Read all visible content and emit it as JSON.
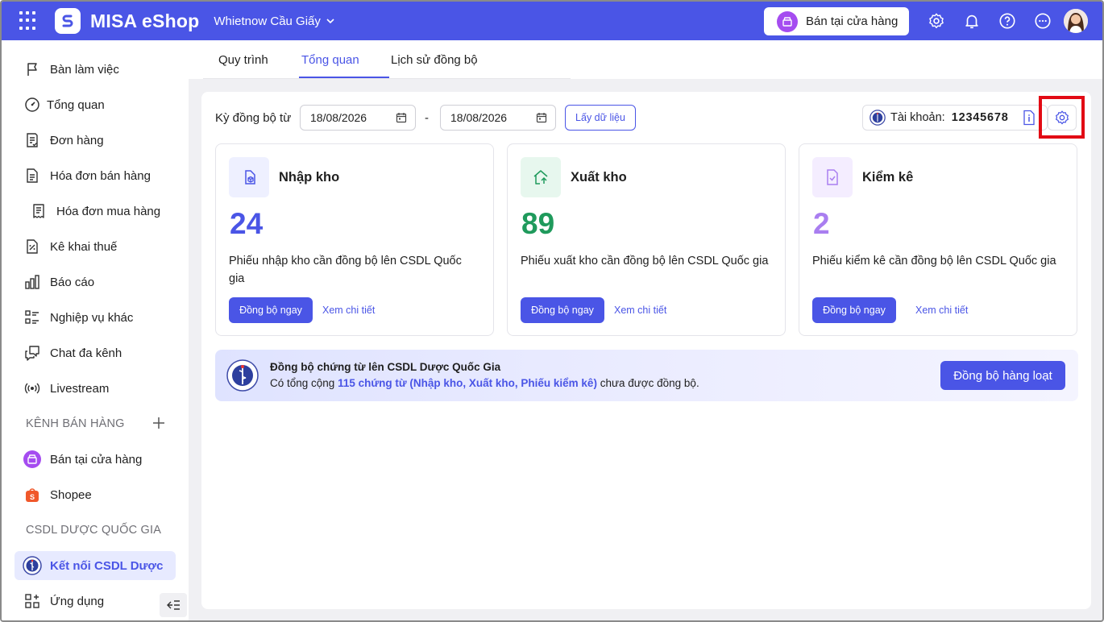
{
  "header": {
    "brand": "MISA eShop",
    "branch": "Whietnow Cầu Giấy",
    "store_button": "Bán tại cửa hàng"
  },
  "sidebar": {
    "items": [
      {
        "label": "Bàn làm việc",
        "icon": "flag-icon"
      },
      {
        "label": "Tổng quan",
        "icon": "gauge-icon"
      },
      {
        "label": "Đơn hàng",
        "icon": "order-icon"
      },
      {
        "label": "Hóa đơn bán hàng",
        "icon": "invoice-icon"
      },
      {
        "label": "Hóa đơn mua hàng",
        "icon": "receipt-icon"
      },
      {
        "label": "Kê khai thuế",
        "icon": "tax-icon"
      },
      {
        "label": "Báo cáo",
        "icon": "chart-icon"
      },
      {
        "label": "Nghiệp vụ khác",
        "icon": "list-icon"
      },
      {
        "label": "Chat đa kênh",
        "icon": "chat-icon"
      },
      {
        "label": "Livestream",
        "icon": "livestream-icon"
      }
    ],
    "sales_section": "KÊNH BÁN HÀNG",
    "sales_channels": [
      {
        "label": "Bán tại cửa hàng",
        "icon": "store-icon"
      },
      {
        "label": "Shopee",
        "icon": "shopee-icon"
      }
    ],
    "pharma_section": "CSDL DƯỢC QUỐC GIA",
    "pharma_item": "Kết nối CSDL Dược",
    "apps_item": "Ứng dụng"
  },
  "tabs": [
    {
      "label": "Quy trình"
    },
    {
      "label": "Tổng quan"
    },
    {
      "label": "Lịch sử đồng bộ"
    }
  ],
  "filter": {
    "label": "Kỳ đồng bộ từ",
    "from_date": "18/08/2026",
    "separator": "-",
    "to_date": "18/08/2026",
    "fetch_button": "Lấy dữ liệu",
    "account_label": "Tài khoản:",
    "account_value": "12345678"
  },
  "cards": [
    {
      "title": "Nhập kho",
      "count": "24",
      "description": "Phiếu nhập kho cần đồng bộ lên CSDL Quốc gia",
      "sync_button": "Đồng bộ ngay",
      "detail_link": "Xem chi tiết",
      "color": "#4a55e6"
    },
    {
      "title": "Xuất kho",
      "count": "89",
      "description": "Phiếu xuất kho cần đồng bộ lên CSDL Quốc gia",
      "sync_button": "Đồng bộ ngay",
      "detail_link": "Xem chi tiết",
      "color": "#1f9a5c"
    },
    {
      "title": "Kiểm kê",
      "count": "2",
      "description": "Phiếu kiểm kê cần đồng bộ lên CSDL Quốc gia",
      "sync_button": "Đồng bộ ngay",
      "detail_link": "Xem chi tiết",
      "color": "#a97ef0"
    }
  ],
  "banner": {
    "title": "Đồng bộ chứng từ lên CSDL Dược Quốc Gia",
    "text_before": "Có tổng cộng ",
    "text_highlight": "115 chứng từ (Nhập kho, Xuất kho, Phiếu kiểm kê)",
    "text_after": " chưa được đồng bộ.",
    "button": "Đồng bộ hàng loạt"
  },
  "colors": {
    "accent": "#4a55e6",
    "highlight_box": "#e20a14"
  }
}
